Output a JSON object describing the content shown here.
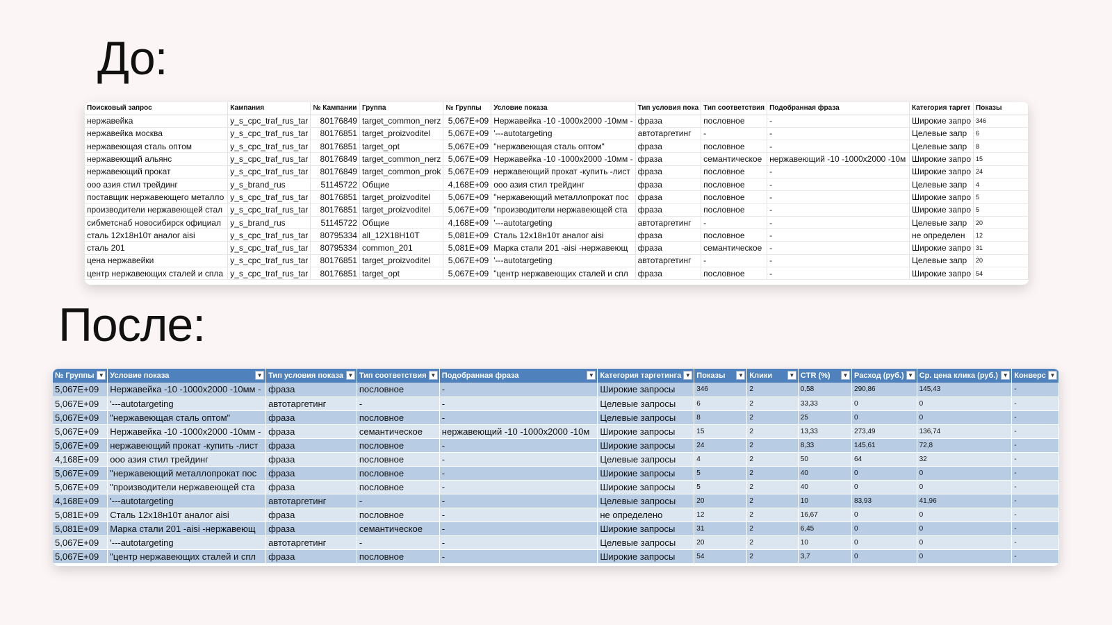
{
  "before": {
    "heading": "До:",
    "columns": [
      "Поисковый запрос",
      "Кампания",
      "№ Кампании",
      "Группа",
      "№ Группы",
      "Условие показа",
      "Тип условия пока",
      "Тип соответствия",
      "Подобранная фраза",
      "Категория таргет",
      "Показы"
    ],
    "rows": [
      [
        "нержавейка",
        "y_s_cpc_traf_rus_tar",
        "80176849",
        "target_common_nerz",
        "5,067E+09",
        "Нержавейка -10 -1000х2000 -10мм -",
        "фраза",
        "пословное",
        "-",
        "Широкие запро",
        "346"
      ],
      [
        "нержавейка москва",
        "y_s_cpc_traf_rus_tar",
        "80176851",
        "target_proizvoditel",
        "5,067E+09",
        "'---autotargeting",
        "автотаргетинг",
        "-",
        "-",
        "Целевые запр",
        "6"
      ],
      [
        "нержавеющая сталь оптом",
        "y_s_cpc_traf_rus_tar",
        "80176851",
        "target_opt",
        "5,067E+09",
        "\"нержавеющая сталь оптом\"",
        "фраза",
        "пословное",
        "-",
        "Целевые запр",
        "8"
      ],
      [
        "нержавеющий альянс",
        "y_s_cpc_traf_rus_tar",
        "80176849",
        "target_common_nerz",
        "5,067E+09",
        "Нержавейка -10 -1000х2000 -10мм -",
        "фраза",
        "семантическое",
        "нержавеющий  -10 -1000х2000 -10м",
        "Широкие запро",
        "15"
      ],
      [
        "нержавеющий прокат",
        "y_s_cpc_traf_rus_tar",
        "80176849",
        "target_common_prok",
        "5,067E+09",
        "нержавеющий прокат -купить -лист",
        "фраза",
        "пословное",
        "-",
        "Широкие запро",
        "24"
      ],
      [
        "ооо азия стил трейдинг",
        "y_s_brand_rus",
        "51145722",
        "Общие",
        "4,168E+09",
        "ооо азия стил трейдинг",
        "фраза",
        "пословное",
        "-",
        "Целевые запр",
        "4"
      ],
      [
        "поставщик нержавеющего металло",
        "y_s_cpc_traf_rus_tar",
        "80176851",
        "target_proizvoditel",
        "5,067E+09",
        "\"нержавеющий металлопрокат пос",
        "фраза",
        "пословное",
        "-",
        "Широкие запро",
        "5"
      ],
      [
        "производители нержавеющей стал",
        "y_s_cpc_traf_rus_tar",
        "80176851",
        "target_proizvoditel",
        "5,067E+09",
        "\"производители нержавеющей ста",
        "фраза",
        "пословное",
        "-",
        "Широкие запро",
        "5"
      ],
      [
        "сибметснаб новосибирск официал",
        "y_s_brand_rus",
        "51145722",
        "Общие",
        "4,168E+09",
        "'---autotargeting",
        "автотаргетинг",
        "-",
        "-",
        "Целевые запр",
        "20"
      ],
      [
        "сталь 12х18н10т аналог aisi",
        "y_s_cpc_traf_rus_tar",
        "80795334",
        "all_12X18H10T",
        "5,081E+09",
        "Сталь 12х18н10т аналог aisi",
        "фраза",
        "пословное",
        "-",
        "не определен",
        "12"
      ],
      [
        "сталь 201",
        "y_s_cpc_traf_rus_tar",
        "80795334",
        "common_201",
        "5,081E+09",
        "Марка стали 201 -aisi -нержавеющ",
        "фраза",
        "семантическое",
        "-",
        "Широкие запро",
        "31"
      ],
      [
        "цена нержавейки",
        "y_s_cpc_traf_rus_tar",
        "80176851",
        "target_proizvoditel",
        "5,067E+09",
        "'---autotargeting",
        "автотаргетинг",
        "-",
        "-",
        "Целевые запр",
        "20"
      ],
      [
        "центр нержавеющих сталей и спла",
        "y_s_cpc_traf_rus_tar",
        "80176851",
        "target_opt",
        "5,067E+09",
        "\"центр нержавеющих сталей и спл",
        "фраза",
        "пословное",
        "-",
        "Широкие запро",
        "54"
      ]
    ]
  },
  "after": {
    "heading": "После:",
    "columns": [
      "№ Группы",
      "Условие показа",
      "Тип условия показа",
      "Тип соответствия",
      "Подобранная фраза",
      "Категория таргетинга",
      "Показы",
      "Клики",
      "CTR (%)",
      "Расход (руб.)",
      "Ср. цена клика (руб.)",
      "Конверс"
    ],
    "rows": [
      [
        "5,067E+09",
        "Нержавейка -10 -1000х2000 -10мм -",
        "фраза",
        "пословное",
        "-",
        "Широкие запросы",
        "346",
        "2",
        "0,58",
        "290,86",
        "145,43",
        "-"
      ],
      [
        "5,067E+09",
        "'---autotargeting",
        "автотаргетинг",
        "-",
        "-",
        "Целевые запросы",
        "6",
        "2",
        "33,33",
        "0",
        "0",
        "-"
      ],
      [
        "5,067E+09",
        "\"нержавеющая сталь оптом\"",
        "фраза",
        "пословное",
        "-",
        "Целевые запросы",
        "8",
        "2",
        "25",
        "0",
        "0",
        "-"
      ],
      [
        "5,067E+09",
        "Нержавейка -10 -1000х2000 -10мм -",
        "фраза",
        "семантическое",
        "нержавеющий  -10 -1000х2000 -10м",
        "Широкие запросы",
        "15",
        "2",
        "13,33",
        "273,49",
        "136,74",
        "-"
      ],
      [
        "5,067E+09",
        "нержавеющий прокат -купить -лист",
        "фраза",
        "пословное",
        "-",
        "Широкие запросы",
        "24",
        "2",
        "8,33",
        "145,61",
        "72,8",
        "-"
      ],
      [
        "4,168E+09",
        "ооо азия стил трейдинг",
        "фраза",
        "пословное",
        "-",
        "Целевые запросы",
        "4",
        "2",
        "50",
        "64",
        "32",
        "-"
      ],
      [
        "5,067E+09",
        "\"нержавеющий металлопрокат пос",
        "фраза",
        "пословное",
        "-",
        "Широкие запросы",
        "5",
        "2",
        "40",
        "0",
        "0",
        "-"
      ],
      [
        "5,067E+09",
        "\"производители нержавеющей ста",
        "фраза",
        "пословное",
        "-",
        "Широкие запросы",
        "5",
        "2",
        "40",
        "0",
        "0",
        "-"
      ],
      [
        "4,168E+09",
        "'---autotargeting",
        "автотаргетинг",
        "-",
        "-",
        "Целевые запросы",
        "20",
        "2",
        "10",
        "83,93",
        "41,96",
        "-"
      ],
      [
        "5,081E+09",
        "Сталь 12х18н10т аналог aisi",
        "фраза",
        "пословное",
        "-",
        "не определено",
        "12",
        "2",
        "16,67",
        "0",
        "0",
        "-"
      ],
      [
        "5,081E+09",
        "Марка стали 201 -aisi -нержавеющ",
        "фраза",
        "семантическое",
        "-",
        "Широкие запросы",
        "31",
        "2",
        "6,45",
        "0",
        "0",
        "-"
      ],
      [
        "5,067E+09",
        "'---autotargeting",
        "автотаргетинг",
        "-",
        "-",
        "Целевые запросы",
        "20",
        "2",
        "10",
        "0",
        "0",
        "-"
      ],
      [
        "5,067E+09",
        "\"центр нержавеющих сталей и спл",
        "фраза",
        "пословное",
        "-",
        "Широкие запросы",
        "54",
        "2",
        "3,7",
        "0",
        "0",
        "-"
      ]
    ]
  }
}
